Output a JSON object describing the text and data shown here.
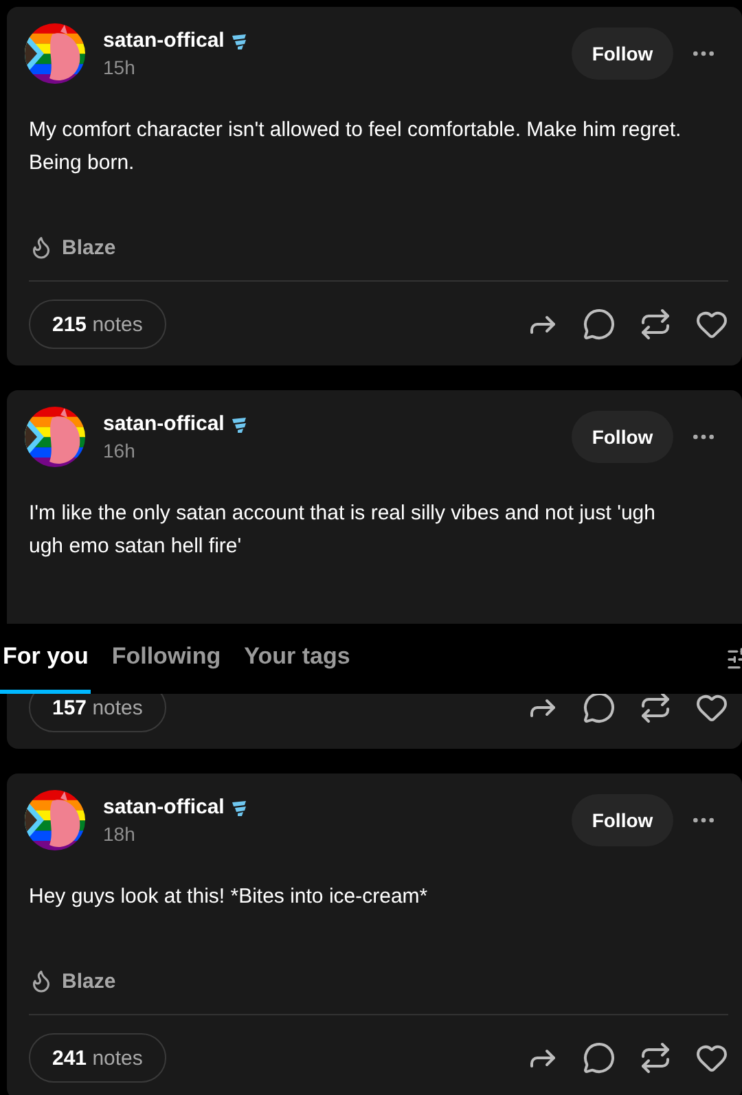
{
  "posts": [
    {
      "author": "satan-offical",
      "time": "15h",
      "follow": "Follow",
      "body": "My comfort character isn't allowed to feel comfortable. Make him regret. Being born.",
      "blaze": "Blaze",
      "notes_count": "215",
      "notes_label": "notes"
    },
    {
      "author": "satan-offical",
      "time": "16h",
      "follow": "Follow",
      "body": "I'm like the only satan account that is real silly vibes and not just 'ugh ugh emo satan hell fire'",
      "notes_count": "157",
      "notes_label": "notes"
    },
    {
      "author": "satan-offical",
      "time": "18h",
      "follow": "Follow",
      "body": "Hey guys look at this! *Bites into ice-cream*",
      "blaze": "Blaze",
      "notes_count": "241",
      "notes_label": "notes"
    }
  ],
  "tabs": [
    {
      "label": "For you",
      "selected": true
    },
    {
      "label": "Following",
      "selected": false
    },
    {
      "label": "Your tags",
      "selected": false
    }
  ]
}
